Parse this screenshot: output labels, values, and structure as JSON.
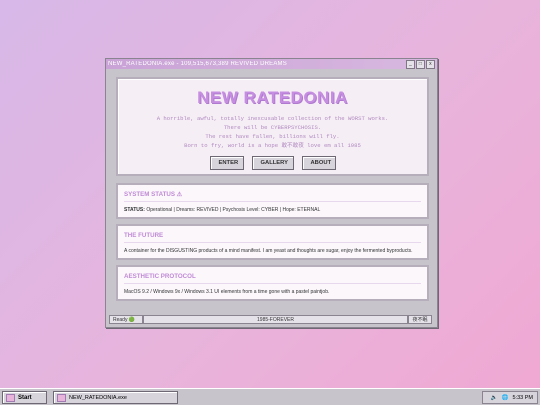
{
  "window": {
    "title": "NEW_RATEDONIA.exe - 109,515,673,389 REVIVED DREAMS",
    "min_label": "_",
    "max_label": "□",
    "close_label": "x"
  },
  "hero": {
    "heading": "NEW RATEDONIA",
    "lines": [
      "A horrible, awful, totally inexcusable collection of the WORST works.",
      "There will be CYBERPSYCHOSIS.",
      "The rest have fallen, billions will fly.",
      "Born to fry, world is a hope 敢不敢夜 love em all 1985"
    ],
    "buttons": [
      "ENTER",
      "GALLERY",
      "ABOUT"
    ]
  },
  "panels": {
    "status": {
      "title": "SYSTEM STATUS ⚠",
      "text_prefix": "STATUS: ",
      "text": "Operational | Dreams: REVIVED | Psychosis Level: CYBER | Hope: ETERNAL"
    },
    "future": {
      "title": "THE FUTURE",
      "text": "A container for the DISGUSTING products of a mind manifest. I am yeast and thoughts are sugar, enjoy the fermented byproducts."
    },
    "protocol": {
      "title": "AESTHETIC PROTOCOL",
      "text": "MacOS 9.2 / Windows 9x / Windows 3.1 UI elements from a time gone with a pastel paintjob."
    }
  },
  "statusbar": {
    "left": "Ready 🟢",
    "center": "1985-FOREVER",
    "right": "夜不眠"
  },
  "taskbar": {
    "start": "Start",
    "task": "NEW_RATEDONIA.exe",
    "clock": "5:33 PM"
  }
}
